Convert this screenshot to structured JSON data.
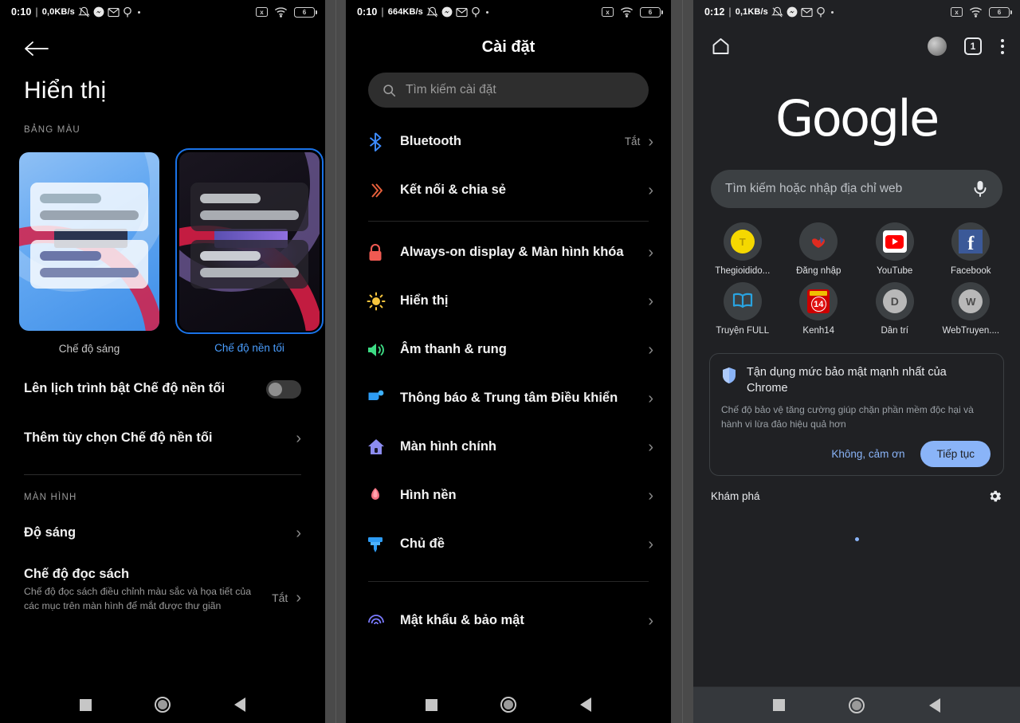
{
  "panels": {
    "display": {
      "statusbar": {
        "time": "0:10",
        "separator": "|",
        "network": "0,0KB/s",
        "battery": "6"
      },
      "back_icon": "back-arrow-icon",
      "title": "Hiển thị",
      "section_color_label": "BẢNG MÀU",
      "themes": [
        {
          "label": "Chế độ sáng",
          "selected": false
        },
        {
          "label": "Chế độ nền tối",
          "selected": true
        }
      ],
      "rows": [
        {
          "label": "Lên lịch trình bật Chế độ nền tối",
          "control": "toggle",
          "value": "off"
        },
        {
          "label": "Thêm tùy chọn Chế độ nền tối",
          "control": "chevron"
        }
      ],
      "section_screen_label": "MÀN HÌNH",
      "rows2": [
        {
          "label": "Độ sáng",
          "control": "chevron"
        },
        {
          "label": "Chế độ đọc sách",
          "sub": "Chế độ đọc sách điều chỉnh màu sắc và họa tiết của các mục trên màn hình để mắt được thư giãn",
          "value": "Tắt",
          "control": "chevron"
        }
      ]
    },
    "settings": {
      "statusbar": {
        "time": "0:10",
        "separator": "|",
        "network": "664KB/s",
        "battery": "6"
      },
      "title": "Cài đặt",
      "search_placeholder": "Tìm kiếm cài đặt",
      "group1": [
        {
          "icon": "bluetooth-icon",
          "label": "Bluetooth",
          "value": "Tắt"
        },
        {
          "icon": "connection-share-icon",
          "label": "Kết nối & chia sẻ",
          "value": ""
        }
      ],
      "group2": [
        {
          "icon": "lock-icon",
          "label": "Always-on display & Màn hình khóa",
          "value": ""
        },
        {
          "icon": "brightness-icon",
          "label": "Hiển thị",
          "value": ""
        },
        {
          "icon": "speaker-icon",
          "label": "Âm thanh & rung",
          "value": ""
        },
        {
          "icon": "notification-icon",
          "label": "Thông báo & Trung tâm Điều khiển",
          "value": ""
        },
        {
          "icon": "home-icon",
          "label": "Màn hình chính",
          "value": ""
        },
        {
          "icon": "wallpaper-flower-icon",
          "label": "Hình nền",
          "value": ""
        },
        {
          "icon": "theme-brush-icon",
          "label": "Chủ đề",
          "value": ""
        }
      ],
      "group3": [
        {
          "icon": "fingerprint-icon",
          "label": "Mật khẩu & bảo mật",
          "value": ""
        }
      ]
    },
    "chrome": {
      "statusbar": {
        "time": "0:12",
        "separator": "|",
        "network": "0,1KB/s",
        "battery": "6"
      },
      "toolbar": {
        "home_icon": "home-icon",
        "avatar": "profile-avatar",
        "tab_count": "1",
        "menu_icon": "kebab-menu-icon"
      },
      "logo": "Google",
      "omnibox_placeholder": "Tìm kiếm hoặc nhập địa chỉ web",
      "mic_icon": "microphone-icon",
      "tiles": [
        {
          "label": "Thegioidido...",
          "glyph": "T",
          "color": "#f5d800",
          "text_color": "#8a6d00"
        },
        {
          "label": "Đăng nhập",
          "glyph": "",
          "color": "#d93025",
          "text_color": "#ffffff"
        },
        {
          "label": "YouTube",
          "glyph": "",
          "color": "#ff0000",
          "text_color": "#ffffff"
        },
        {
          "label": "Facebook",
          "glyph": "f",
          "color": "#3b5998",
          "text_color": "#ffffff"
        },
        {
          "label": "Truyện FULL",
          "glyph": "",
          "color": "#29a3e0",
          "text_color": "#ffffff"
        },
        {
          "label": "Kenh14",
          "glyph": "14",
          "color": "#cc0000",
          "text_color": "#ffffff"
        },
        {
          "label": "Dân trí",
          "glyph": "D",
          "color": "#bdbdbd",
          "text_color": "#4a4a4a"
        },
        {
          "label": "WebTruyen....",
          "glyph": "W",
          "color": "#bdbdbd",
          "text_color": "#4a4a4a"
        }
      ],
      "promo": {
        "icon": "shield-icon",
        "title": "Tận dụng mức bảo mật mạnh nhất của Chrome",
        "body": "Chế độ bảo vệ tăng cường giúp chặn phần mềm độc hại và hành vi lừa đảo hiệu quả hơn",
        "dismiss_label": "Không, cảm ơn",
        "accept_label": "Tiếp tục"
      },
      "discover_label": "Khám phá",
      "discover_settings_icon": "gear-icon"
    }
  },
  "navbar": {
    "recents_icon": "recents-square-icon",
    "home_icon": "home-circle-icon",
    "back_icon": "back-triangle-icon"
  },
  "colors": {
    "accent_blue": "#1a73e8",
    "chrome_blue": "#8ab4f8",
    "panel_dark": "#202124",
    "gap": "#4a4a4a"
  }
}
